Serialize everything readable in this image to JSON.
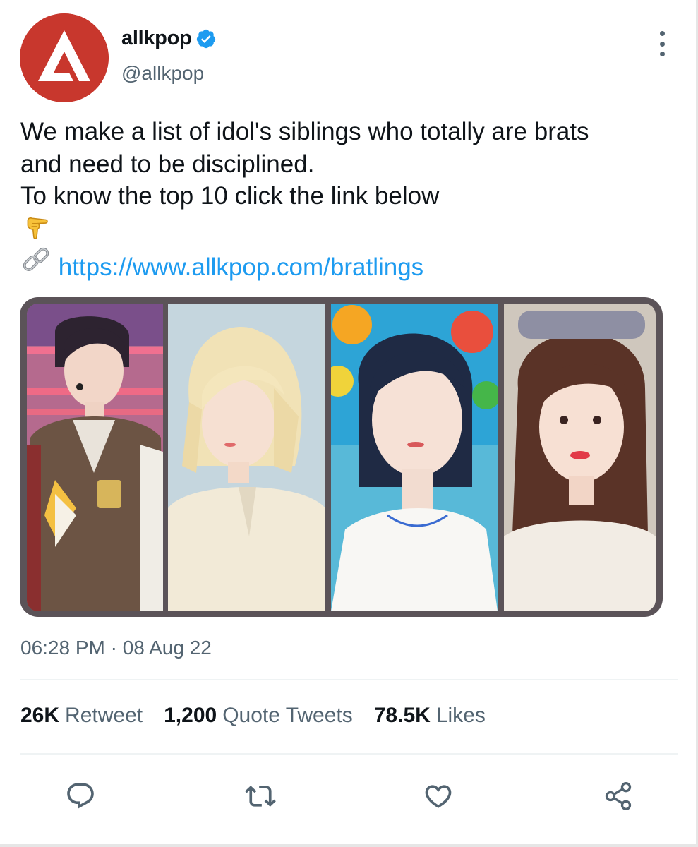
{
  "author": {
    "display_name": "allkpop",
    "handle": "@allkpop",
    "verified": true,
    "avatar_icon": "allkpop-logo-icon",
    "avatar_color": "#c8372d",
    "verified_color": "#1d9bf0"
  },
  "tweet": {
    "lines": [
      "We make a list of idol's siblings who totally are brats",
      "and need to be disciplined.",
      "To know the top 10 click the link below"
    ],
    "emoji_pointing": "backhand-index-pointing-down-icon",
    "link_icon": "link-chain-icon",
    "link_text": "https://www.allkpop.com/bratlings",
    "link_color": "#1d9bf0"
  },
  "media": {
    "photos": [
      "idol-photo-1",
      "idol-photo-2",
      "idol-photo-3",
      "idol-photo-4"
    ]
  },
  "timestamp": "06:28 PM · 08 Aug 22",
  "stats": [
    {
      "count": "26K",
      "label": "Retweet"
    },
    {
      "count": "1,200",
      "label": "Quote Tweets"
    },
    {
      "count": "78.5K",
      "label": "Likes"
    }
  ],
  "actions": [
    "reply-icon",
    "retweet-icon",
    "like-icon",
    "share-icon"
  ],
  "colors": {
    "text_primary": "#0f1419",
    "text_secondary": "#536471",
    "divider": "#eff3f4",
    "media_frame": "#5b5358"
  }
}
